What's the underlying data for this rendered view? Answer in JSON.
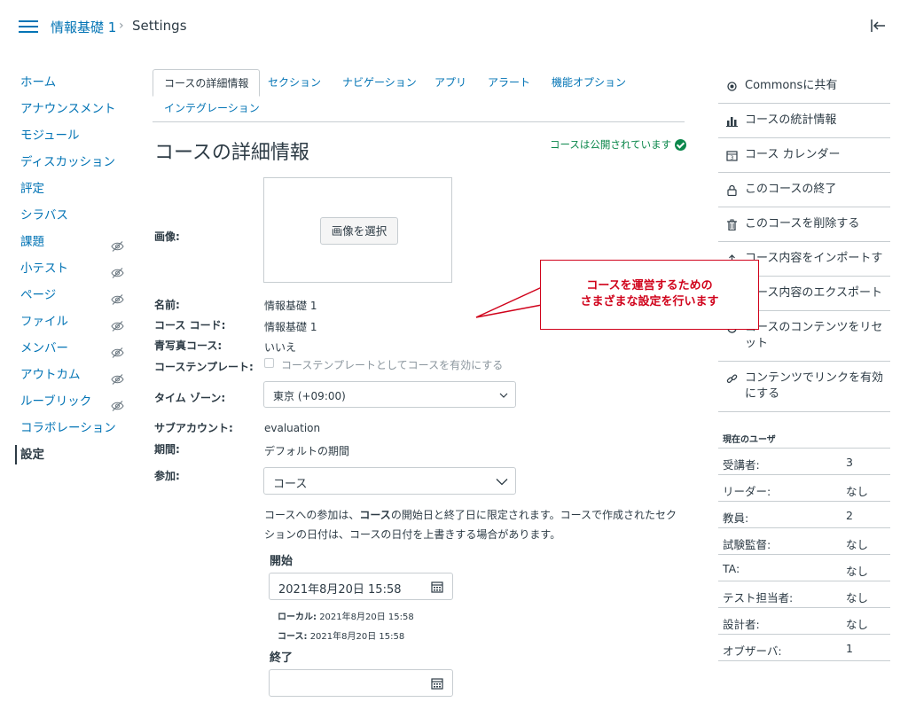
{
  "breadcrumb": {
    "course": "情報基礎 1",
    "separator": "›",
    "current": "Settings"
  },
  "left_nav": [
    {
      "label": "ホーム",
      "hidden": false
    },
    {
      "label": "アナウンスメント",
      "hidden": false
    },
    {
      "label": "モジュール",
      "hidden": false
    },
    {
      "label": "ディスカッション",
      "hidden": false
    },
    {
      "label": "評定",
      "hidden": false
    },
    {
      "label": "シラバス",
      "hidden": false
    },
    {
      "label": "課題",
      "hidden": true
    },
    {
      "label": "小テスト",
      "hidden": true
    },
    {
      "label": "ページ",
      "hidden": true
    },
    {
      "label": "ファイル",
      "hidden": true
    },
    {
      "label": "メンバー",
      "hidden": true
    },
    {
      "label": "アウトカム",
      "hidden": true
    },
    {
      "label": "ルーブリック",
      "hidden": true
    },
    {
      "label": "コラボレーション",
      "hidden": false
    },
    {
      "label": "設定",
      "hidden": false,
      "active": true
    }
  ],
  "tabs": [
    "コースの詳細情報",
    "セクション",
    "ナビゲーション",
    "アプリ",
    "アラート",
    "機能オプション",
    "インテグレーション"
  ],
  "page": {
    "title": "コースの詳細情報",
    "published": "コースは公開されています",
    "image_label": "画像:",
    "image_button": "画像を選択",
    "name_label": "名前:",
    "name_value": "情報基礎 1",
    "code_label": "コース コード:",
    "code_value": "情報基礎 1",
    "blueprint_label": "青写真コース:",
    "blueprint_value": "いいえ",
    "template_label": "コーステンプレート:",
    "template_checkbox": "コーステンプレートとしてコースを有効にする",
    "timezone_label": "タイム ゾーン:",
    "timezone_value": "東京 (+09:00)",
    "subaccount_label": "サブアカウント:",
    "subaccount_value": "evaluation",
    "term_label": "期間:",
    "term_value": "デフォルトの期間",
    "participation_label": "参加:",
    "participation_value": "コース",
    "note_1": "コースへの参加は、",
    "note_bold": "コース",
    "note_2": "の開始日と終了日に限定されます。コースで作成されたセクションの日付は、コースの日付を上書きする場合があります。",
    "start_label": "開始",
    "start_value": "2021年8月20日 15:58",
    "local_label": "ローカル:",
    "local_value": "2021年8月20日 15:58",
    "course_label": "コース:",
    "course_value": "2021年8月20日 15:58",
    "end_label": "終了",
    "end_value": ""
  },
  "right_actions": [
    {
      "icon": "commons-icon",
      "label": "Commonsに共有"
    },
    {
      "icon": "bar-chart-icon",
      "label": "コースの統計情報"
    },
    {
      "icon": "calendar-icon",
      "label": "コース カレンダー"
    },
    {
      "icon": "lock-icon",
      "label": "このコースの終了"
    },
    {
      "icon": "trash-icon",
      "label": "このコースを削除する"
    },
    {
      "icon": "upload-icon",
      "label": "コース内容をインポートす"
    },
    {
      "icon": "download-icon",
      "label": "コース内容のエクスポート"
    },
    {
      "icon": "reset-icon",
      "label": "コースのコンテンツをリセット"
    },
    {
      "icon": "link-icon",
      "label": "コンテンツでリンクを有効にする"
    }
  ],
  "users": {
    "title": "現在のユーザ",
    "rows": [
      {
        "k": "受講者:",
        "v": "3"
      },
      {
        "k": "リーダー:",
        "v": "なし"
      },
      {
        "k": "教員:",
        "v": "2"
      },
      {
        "k": "試験監督:",
        "v": "なし"
      },
      {
        "k": "TA:",
        "v": "なし"
      },
      {
        "k": "テスト担当者:",
        "v": "なし"
      },
      {
        "k": "設計者:",
        "v": "なし"
      },
      {
        "k": "オブザーバ:",
        "v": "1"
      }
    ]
  },
  "callout": {
    "line1": "コースを運営するための",
    "line2": "さまざまな設定を行います"
  },
  "colors": {
    "link": "#0374b5",
    "text": "#2d3b45",
    "published": "#0b874b",
    "callout": "#d0021b",
    "border": "#c7cdd1"
  }
}
